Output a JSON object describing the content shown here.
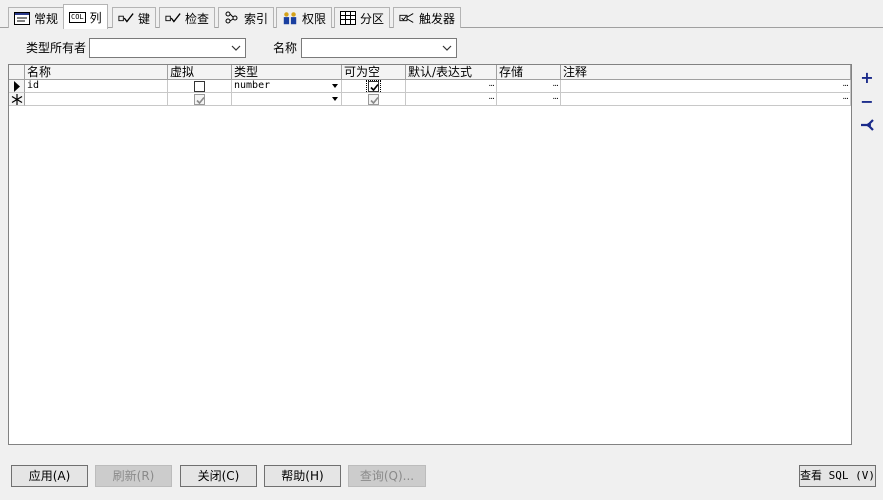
{
  "tabs": [
    {
      "label": "常规",
      "icon": "form-icon"
    },
    {
      "label": "列",
      "icon": "column-icon",
      "icon_text": "COL",
      "active": true
    },
    {
      "label": "键",
      "icon": "key-icon"
    },
    {
      "label": "检查",
      "icon": "check-icon"
    },
    {
      "label": "索引",
      "icon": "index-icon"
    },
    {
      "label": "权限",
      "icon": "users-icon"
    },
    {
      "label": "分区",
      "icon": "table-icon"
    },
    {
      "label": "触发器",
      "icon": "trigger-icon"
    }
  ],
  "form": {
    "type_owner_label": "类型所有者",
    "type_owner_value": "",
    "name_label": "名称",
    "name_value": ""
  },
  "grid": {
    "headers": [
      "名称",
      "虚拟",
      "类型",
      "可为空",
      "默认/表达式",
      "存储",
      "注释"
    ],
    "rows": [
      {
        "name": "id",
        "virtual": false,
        "type": "number",
        "nullable": true,
        "default": "",
        "storage": "",
        "comment": ""
      },
      {
        "name": "",
        "virtual": true,
        "type": "",
        "nullable": true,
        "default": "",
        "storage": "",
        "comment": ""
      }
    ],
    "ellipsis": "..."
  },
  "side_buttons": {
    "add": "+",
    "remove": "−"
  },
  "buttons": {
    "apply": "应用(A)",
    "refresh": "刷新(R)",
    "close": "关闭(C)",
    "help": "帮助(H)",
    "query": "查询(Q)...",
    "view_sql": "查看 SQL (V)"
  }
}
